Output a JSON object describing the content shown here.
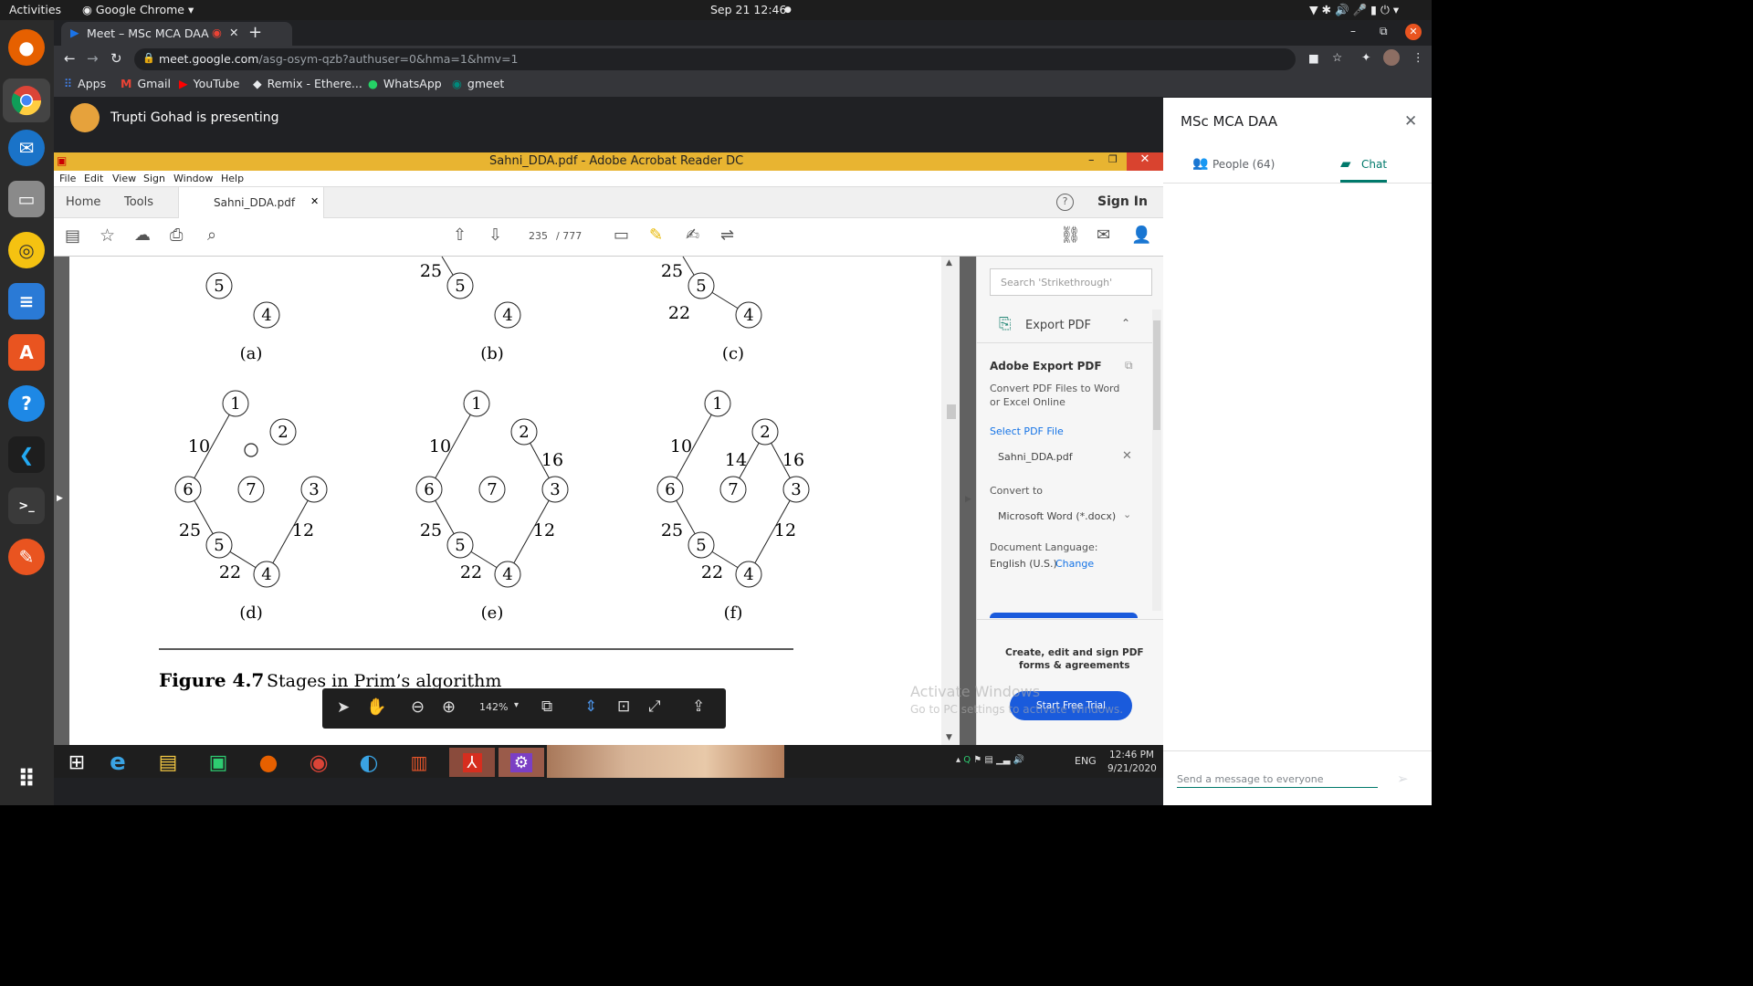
{
  "topbar": {
    "activities": "Activities",
    "app": "Google Chrome",
    "datetime": "Sep 21  12:46"
  },
  "chrome": {
    "tab_title": "Meet – MSc MCA DAA",
    "url_host": "meet.google.com",
    "url_path": "/asg-osym-qzb?authuser=0&hma=1&hmv=1",
    "bookmarks": [
      "Apps",
      "Gmail",
      "YouTube",
      "Remix - Ethere...",
      "WhatsApp",
      "gmeet"
    ]
  },
  "meet": {
    "presenter_text": "Trupti Gohad is presenting",
    "sidebar_title": "MSc MCA DAA",
    "tab_people": "People (64)",
    "tab_chat": "Chat",
    "chat_placeholder": "Send a message to everyone"
  },
  "acrobat": {
    "window_title": "Sahni_DDA.pdf - Adobe Acrobat Reader DC",
    "menu": [
      "File",
      "Edit",
      "View",
      "Sign",
      "Window",
      "Help"
    ],
    "tabs": {
      "home": "Home",
      "tools": "Tools",
      "file": "Sahni_DDA.pdf"
    },
    "sign_in": "Sign In",
    "page_current": "235",
    "page_total": "/  777",
    "zoom": "142%",
    "figure_caption_bold": "Figure 4.7",
    "figure_caption_text": "Stages in Prim’s algorithm",
    "panel": {
      "search_placeholder": "Search 'Strikethrough'",
      "export_title": "Export PDF",
      "adobe_export": "Adobe Export PDF",
      "convert_desc_1": "Convert PDF Files to Word",
      "convert_desc_2": "or Excel Online",
      "select_file": "Select PDF File",
      "file_name": "Sahni_DDA.pdf",
      "convert_to": "Convert to",
      "convert_option": "Microsoft Word (*.docx)",
      "doc_language": "Document Language:",
      "language": "English (U.S.)",
      "change": "Change",
      "promo_1": "Create, edit and sign PDF",
      "promo_2": "forms & agreements",
      "trial": "Start Free Trial"
    },
    "watermark_1": "Activate Windows",
    "watermark_2": "Go to PC settings to activate Windows."
  },
  "windows": {
    "time": "12:46 PM",
    "date": "9/21/2020",
    "lang": "ENG"
  },
  "graph_labels": {
    "sub": [
      "(a)",
      "(b)",
      "(c)",
      "(d)",
      "(e)",
      "(f)"
    ],
    "w10": "10",
    "w25": "25",
    "w22": "22",
    "w12": "12",
    "w16": "16",
    "w14": "14",
    "n1": "1",
    "n2": "2",
    "n3": "3",
    "n4": "4",
    "n5": "5",
    "n6": "6",
    "n7": "7"
  }
}
